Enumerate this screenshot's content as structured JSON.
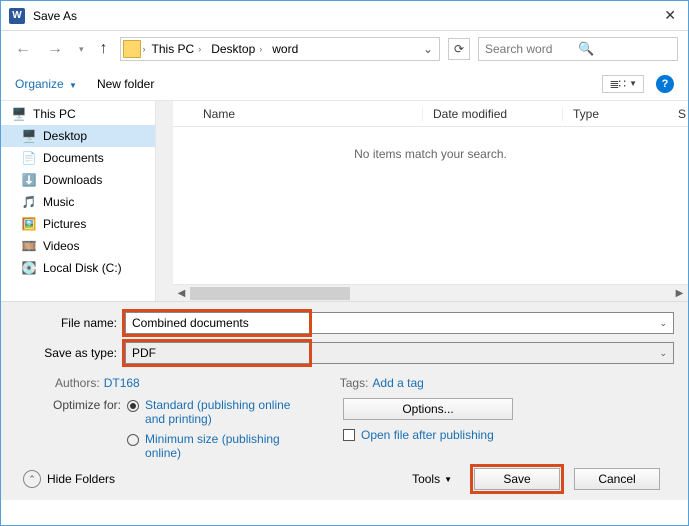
{
  "title": "Save As",
  "path": {
    "root": "This PC",
    "items": [
      "Desktop",
      "word"
    ]
  },
  "search_placeholder": "Search word",
  "toolbar": {
    "organize": "Organize",
    "newfolder": "New folder"
  },
  "tree": {
    "root": "This PC",
    "items": [
      "Desktop",
      "Documents",
      "Downloads",
      "Music",
      "Pictures",
      "Videos",
      "Local Disk (C:)"
    ],
    "selected_index": 0
  },
  "columns": {
    "name": "Name",
    "date": "Date modified",
    "type": "Type",
    "size_initial": "S"
  },
  "empty_msg": "No items match your search.",
  "file": {
    "name_label": "File name:",
    "name_value": "Combined documents",
    "type_label": "Save as type:",
    "type_value": "PDF"
  },
  "meta": {
    "authors_label": "Authors:",
    "authors_value": "DT168",
    "tags_label": "Tags:",
    "tags_value": "Add a tag"
  },
  "optimize": {
    "label": "Optimize for:",
    "opt1": "Standard (publishing online and printing)",
    "opt2": "Minimum size (publishing online)"
  },
  "options_btn": "Options...",
  "open_after": "Open file after publishing",
  "footer": {
    "hide": "Hide Folders",
    "tools": "Tools",
    "save": "Save",
    "cancel": "Cancel"
  }
}
